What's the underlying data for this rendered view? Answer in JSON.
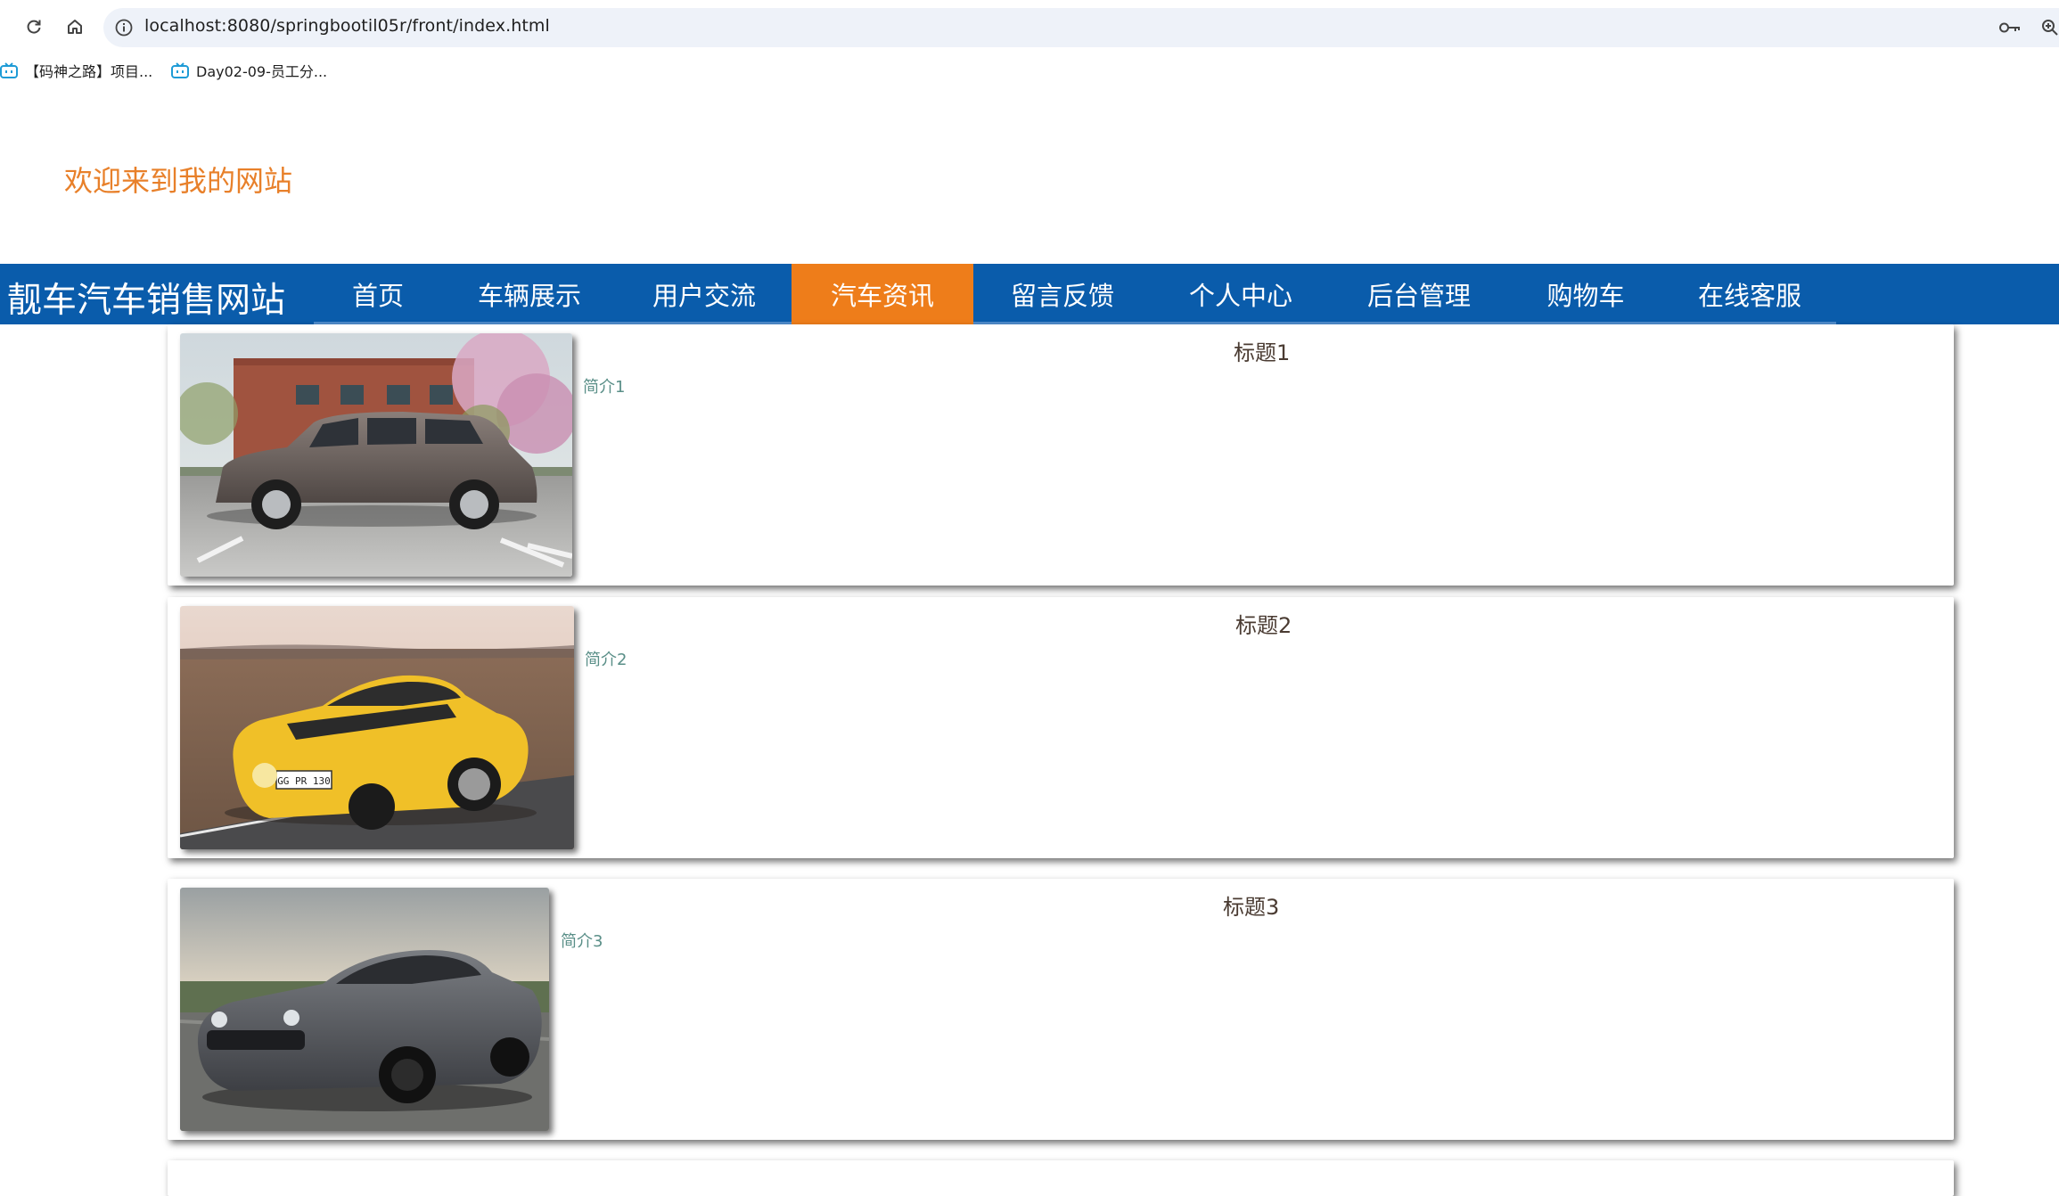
{
  "browser": {
    "url": "localhost:8080/springbootil05r/front/index.html",
    "bookmarks": [
      {
        "label": "【码神之路】项目..."
      },
      {
        "label": "Day02-09-员工分..."
      }
    ]
  },
  "header": {
    "welcome": "欢迎来到我的网站"
  },
  "navbar": {
    "site_title": "靓车汽车销售网站",
    "items": [
      {
        "label": "首页"
      },
      {
        "label": "车辆展示"
      },
      {
        "label": "用户交流"
      },
      {
        "label": "汽车资讯",
        "active": true
      },
      {
        "label": "留言反馈"
      },
      {
        "label": "个人中心"
      },
      {
        "label": "后台管理"
      },
      {
        "label": "购物车"
      },
      {
        "label": "在线客服"
      }
    ]
  },
  "news": [
    {
      "title": "标题1",
      "summary": "简介1",
      "image": "grey-minivan-photo"
    },
    {
      "title": "标题2",
      "summary": "简介2",
      "image": "yellow-sports-car-photo",
      "plate": "GG PR 130"
    },
    {
      "title": "标题3",
      "summary": "简介3",
      "image": "grey-muscle-car-photo"
    }
  ],
  "colors": {
    "navbar": "#0a5cab",
    "active": "#ee7d1a",
    "welcome": "#e8802a"
  }
}
